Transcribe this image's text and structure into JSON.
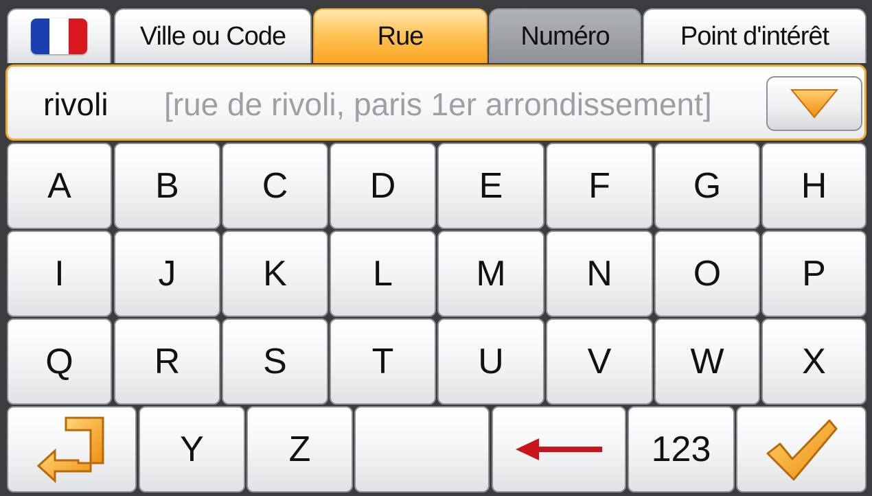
{
  "tabs": {
    "flag_colors": [
      "#1a3fb0",
      "#ffffff",
      "#d8171e"
    ],
    "ville": "Ville ou Code",
    "rue": "Rue",
    "numero": "Numéro",
    "poi": "Point d'intérêt",
    "active": "Rue"
  },
  "search": {
    "typed": "rivoli",
    "suggestion": "[rue de rivoli, paris 1er arrondissement]",
    "dropdown_icon": "triangle-down-icon"
  },
  "keyboard": {
    "row1": [
      "A",
      "B",
      "C",
      "D",
      "E",
      "F",
      "G",
      "H"
    ],
    "row2": [
      "I",
      "J",
      "K",
      "L",
      "M",
      "N",
      "O",
      "P"
    ],
    "row3": [
      "Q",
      "R",
      "S",
      "T",
      "U",
      "V",
      "W",
      "X"
    ],
    "row4": {
      "back_icon": "back-arrow-icon",
      "y": "Y",
      "z": "Z",
      "space_icon": "space-key",
      "backspace_icon": "backspace-arrow-icon",
      "numbers": "123",
      "confirm_icon": "checkmark-icon"
    }
  },
  "colors": {
    "accent": "#f9a521",
    "backspace": "#c8141a",
    "confirm": "#f5a623"
  }
}
